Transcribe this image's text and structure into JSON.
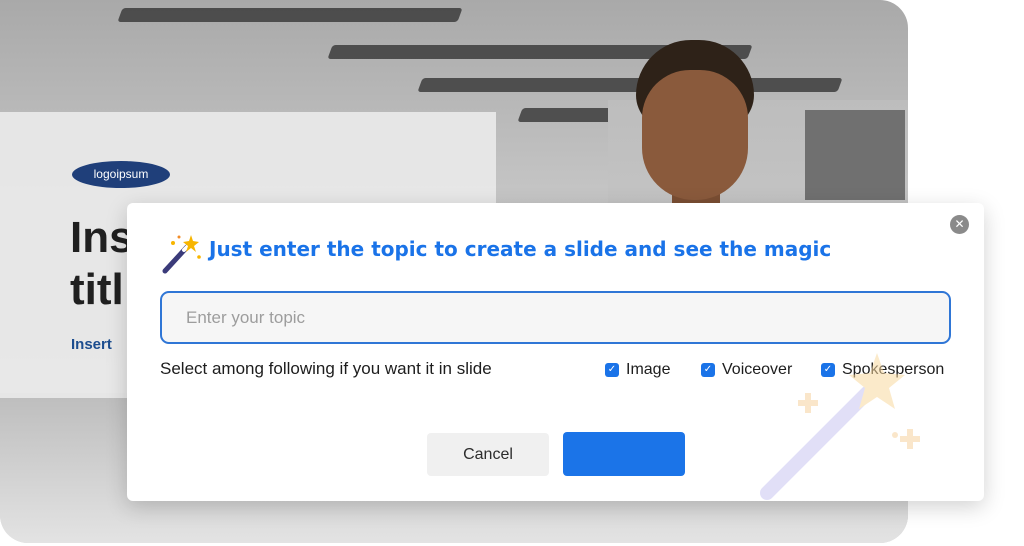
{
  "slide": {
    "logo_text": "logoipsum",
    "title": "Ins\ntitl",
    "subtitle": "Insert"
  },
  "modal": {
    "title": "Just enter the topic to create a slide and see the magic",
    "close_symbol": "✕",
    "input": {
      "placeholder": "Enter your topic",
      "value": ""
    },
    "select_label": "Select among following if you want it in slide",
    "options": [
      {
        "label": "Image",
        "checked": true
      },
      {
        "label": "Voiceover",
        "checked": true
      },
      {
        "label": "Spokesperson",
        "checked": true
      }
    ],
    "cancel_label": "Cancel",
    "primary_label": ""
  },
  "colors": {
    "accent": "#1a73e8",
    "logo": "#1f3f7a"
  },
  "icons": {
    "wand": "magic-wand-icon",
    "close": "close-icon",
    "check": "checkmark-icon"
  }
}
